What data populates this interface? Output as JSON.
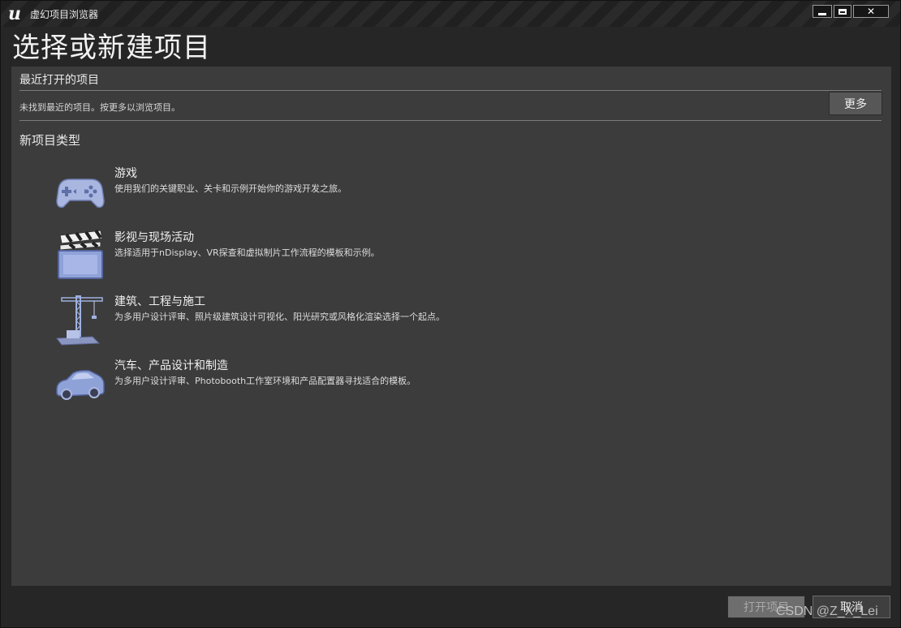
{
  "window": {
    "title": "虚幻项目浏览器",
    "close_label": "✕"
  },
  "page": {
    "title": "选择或新建项目"
  },
  "recent": {
    "header": "最近打开的项目",
    "message": "未找到最近的项目。按更多以浏览项目。",
    "more_label": "更多"
  },
  "new_types": {
    "header": "新项目类型",
    "items": [
      {
        "icon": "gamepad-icon",
        "title": "游戏",
        "desc": "使用我们的关键职业、关卡和示例开始你的游戏开发之旅。"
      },
      {
        "icon": "clapperboard-icon",
        "title": "影视与现场活动",
        "desc": "选择适用于nDisplay、VR探查和虚拟制片工作流程的模板和示例。"
      },
      {
        "icon": "crane-icon",
        "title": "建筑、工程与施工",
        "desc": "为多用户设计评审、照片级建筑设计可视化、阳光研究或风格化渲染选择一个起点。"
      },
      {
        "icon": "car-icon",
        "title": "汽车、产品设计和制造",
        "desc": "为多用户设计评审、Photobooth工作室环境和产品配置器寻找适合的模板。"
      }
    ]
  },
  "footer": {
    "open_label": "打开项目",
    "cancel_label": "取消"
  },
  "watermark": "CSDN @Z_X_Lei",
  "colors": {
    "accent_icon": "#8fa2d8",
    "panel": "#3c3c3c",
    "background": "#262626"
  }
}
